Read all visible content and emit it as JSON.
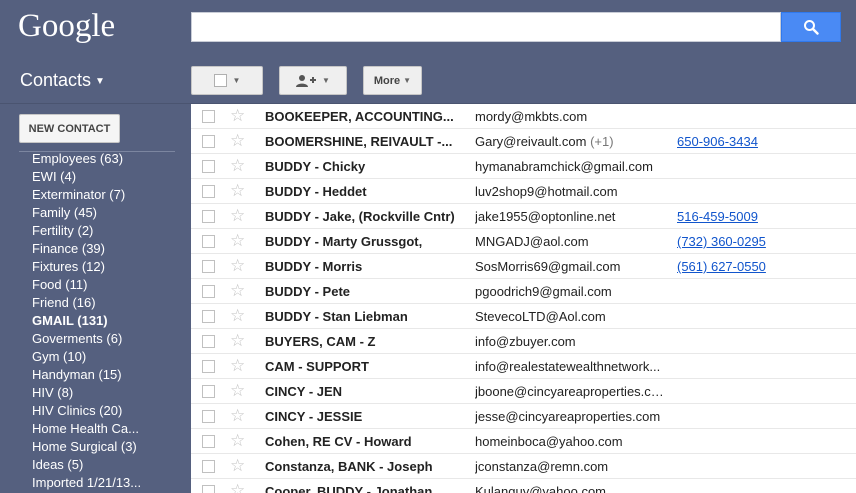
{
  "header": {
    "logo": "Google",
    "search_value": ""
  },
  "toolbar": {
    "contacts_label": "Contacts",
    "more_label": "More"
  },
  "sidebar": {
    "new_contact_label": "NEW CONTACT",
    "groups": [
      {
        "label": "Employees (63)",
        "bold": false
      },
      {
        "label": "EWI (4)",
        "bold": false
      },
      {
        "label": "Exterminator (7)",
        "bold": false
      },
      {
        "label": "Family (45)",
        "bold": false
      },
      {
        "label": "Fertility (2)",
        "bold": false
      },
      {
        "label": "Finance (39)",
        "bold": false
      },
      {
        "label": "Fixtures (12)",
        "bold": false
      },
      {
        "label": "Food (11)",
        "bold": false
      },
      {
        "label": "Friend (16)",
        "bold": false
      },
      {
        "label": "GMAIL (131)",
        "bold": true
      },
      {
        "label": "Goverments (6)",
        "bold": false
      },
      {
        "label": "Gym (10)",
        "bold": false
      },
      {
        "label": "Handyman (15)",
        "bold": false
      },
      {
        "label": "HIV (8)",
        "bold": false
      },
      {
        "label": "HIV Clinics (20)",
        "bold": false
      },
      {
        "label": "Home Health Ca...",
        "bold": false
      },
      {
        "label": "Home Surgical (3)",
        "bold": false
      },
      {
        "label": "Ideas (5)",
        "bold": false
      },
      {
        "label": "Imported 1/21/13...",
        "bold": false
      }
    ]
  },
  "contacts": [
    {
      "name": "BOOKEEPER, ACCOUNTING...",
      "email": "mordy@mkbts.com",
      "extra": "",
      "phone": ""
    },
    {
      "name": "BOOMERSHINE, REIVAULT -...",
      "email": "Gary@reivault.com",
      "extra": "(+1)",
      "phone": "650-906-3434"
    },
    {
      "name": "BUDDY - Chicky",
      "email": "hymanabramchick@gmail.com",
      "extra": "",
      "phone": ""
    },
    {
      "name": "BUDDY - Heddet",
      "email": "luv2shop9@hotmail.com",
      "extra": "",
      "phone": ""
    },
    {
      "name": "BUDDY - Jake, (Rockville Cntr)",
      "email": "jake1955@optonline.net",
      "extra": "",
      "phone": "516-459-5009"
    },
    {
      "name": "BUDDY - Marty Grussgot,",
      "email": "MNGADJ@aol.com",
      "extra": "",
      "phone": "(732) 360-0295"
    },
    {
      "name": "BUDDY - Morris",
      "email": "SosMorris69@gmail.com",
      "extra": "",
      "phone": "(561) 627-0550"
    },
    {
      "name": "BUDDY - Pete",
      "email": "pgoodrich9@gmail.com",
      "extra": "",
      "phone": ""
    },
    {
      "name": "BUDDY - Stan Liebman",
      "email": "StevecoLTD@Aol.com",
      "extra": "",
      "phone": ""
    },
    {
      "name": "BUYERS, CAM - Z",
      "email": "info@zbuyer.com",
      "extra": "",
      "phone": ""
    },
    {
      "name": "CAM - SUPPORT",
      "email": "info@realestatewealthnetwork...",
      "extra": "",
      "phone": ""
    },
    {
      "name": "CINCY - JEN",
      "email": "jboone@cincyareaproperties.com",
      "extra": "",
      "phone": ""
    },
    {
      "name": "CINCY - JESSIE",
      "email": "jesse@cincyareaproperties.com",
      "extra": "",
      "phone": ""
    },
    {
      "name": "Cohen, RE CV - Howard",
      "email": "homeinboca@yahoo.com",
      "extra": "",
      "phone": ""
    },
    {
      "name": "Constanza, BANK - Joseph",
      "email": "jconstanza@remn.com",
      "extra": "",
      "phone": ""
    },
    {
      "name": "Cooper, BUDDY - Jonathan",
      "email": "Kulanguy@yahoo.com",
      "extra": "",
      "phone": ""
    }
  ]
}
